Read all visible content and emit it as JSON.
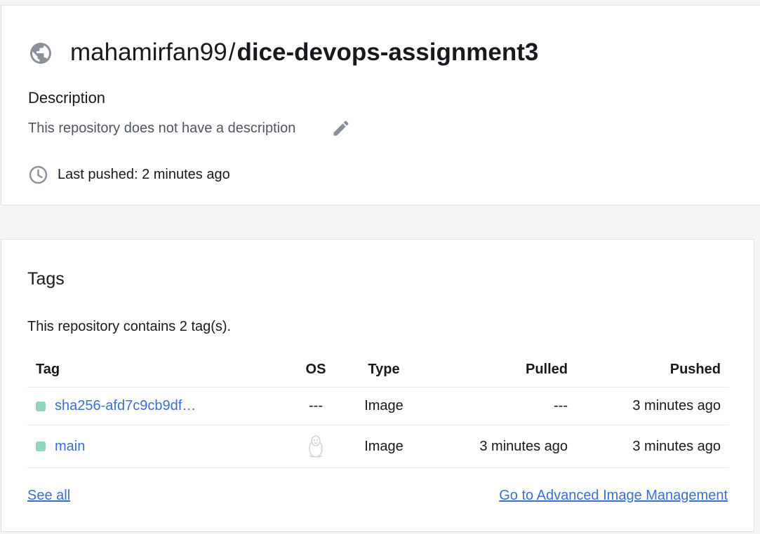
{
  "repo": {
    "namespace": "mahamirfan99",
    "separator": "/",
    "name": "dice-devops-assignment3",
    "visibility_icon": "globe-icon",
    "description_heading": "Description",
    "description_text": "This repository does not have a description",
    "last_pushed": "Last pushed: 2 minutes ago"
  },
  "tags": {
    "heading": "Tags",
    "count_text": "This repository contains 2 tag(s).",
    "columns": {
      "tag": "Tag",
      "os": "OS",
      "type": "Type",
      "pulled": "Pulled",
      "pushed": "Pushed"
    },
    "rows": [
      {
        "tag": "sha256-afd7c9cb9df…",
        "os": "---",
        "type": "Image",
        "pulled": "---",
        "pushed": "3 minutes ago"
      },
      {
        "tag": "main",
        "os_icon": "linux-tux-icon",
        "type": "Image",
        "pulled": "3 minutes ago",
        "pushed": "3 minutes ago"
      }
    ],
    "see_all": "See all",
    "advanced_link": "Go to Advanced Image Management"
  },
  "colors": {
    "link": "#3a6fcf",
    "status_dot": "#8fd6c0",
    "icon_gray": "#8a8f9c",
    "border": "#dfe1e6",
    "background": "#f4f4f6"
  }
}
